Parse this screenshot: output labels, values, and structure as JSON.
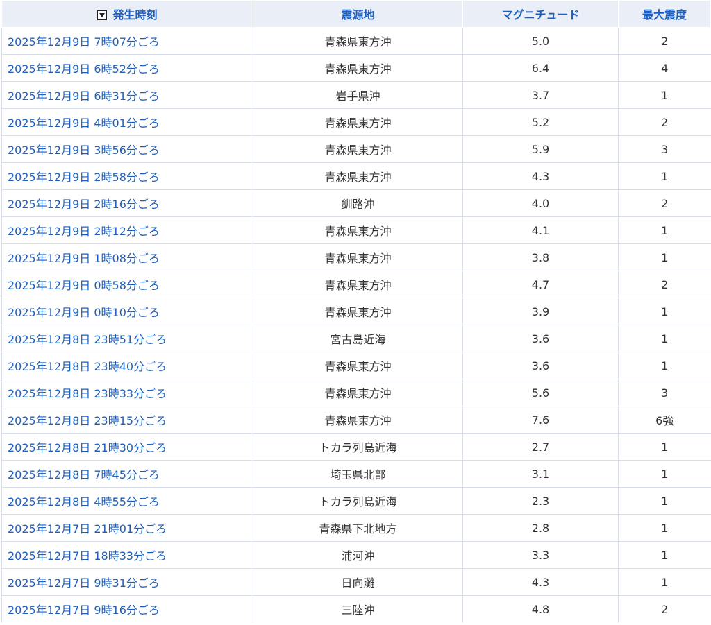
{
  "header": {
    "time_label": "発生時刻",
    "epicenter_label": "震源地",
    "magnitude_label": "マグニチュード",
    "intensity_label": "最大震度",
    "sort_icon": "sort-descending-icon"
  },
  "rows": [
    {
      "time": "2025年12月9日 7時07分ごろ",
      "epicenter": "青森県東方沖",
      "magnitude": "5.0",
      "intensity": "2"
    },
    {
      "time": "2025年12月9日 6時52分ごろ",
      "epicenter": "青森県東方沖",
      "magnitude": "6.4",
      "intensity": "4"
    },
    {
      "time": "2025年12月9日 6時31分ごろ",
      "epicenter": "岩手県沖",
      "magnitude": "3.7",
      "intensity": "1"
    },
    {
      "time": "2025年12月9日 4時01分ごろ",
      "epicenter": "青森県東方沖",
      "magnitude": "5.2",
      "intensity": "2"
    },
    {
      "time": "2025年12月9日 3時56分ごろ",
      "epicenter": "青森県東方沖",
      "magnitude": "5.9",
      "intensity": "3"
    },
    {
      "time": "2025年12月9日 2時58分ごろ",
      "epicenter": "青森県東方沖",
      "magnitude": "4.3",
      "intensity": "1"
    },
    {
      "time": "2025年12月9日 2時16分ごろ",
      "epicenter": "釧路沖",
      "magnitude": "4.0",
      "intensity": "2"
    },
    {
      "time": "2025年12月9日 2時12分ごろ",
      "epicenter": "青森県東方沖",
      "magnitude": "4.1",
      "intensity": "1"
    },
    {
      "time": "2025年12月9日 1時08分ごろ",
      "epicenter": "青森県東方沖",
      "magnitude": "3.8",
      "intensity": "1"
    },
    {
      "time": "2025年12月9日 0時58分ごろ",
      "epicenter": "青森県東方沖",
      "magnitude": "4.7",
      "intensity": "2"
    },
    {
      "time": "2025年12月9日 0時10分ごろ",
      "epicenter": "青森県東方沖",
      "magnitude": "3.9",
      "intensity": "1"
    },
    {
      "time": "2025年12月8日 23時51分ごろ",
      "epicenter": "宮古島近海",
      "magnitude": "3.6",
      "intensity": "1"
    },
    {
      "time": "2025年12月8日 23時40分ごろ",
      "epicenter": "青森県東方沖",
      "magnitude": "3.6",
      "intensity": "1"
    },
    {
      "time": "2025年12月8日 23時33分ごろ",
      "epicenter": "青森県東方沖",
      "magnitude": "5.6",
      "intensity": "3"
    },
    {
      "time": "2025年12月8日 23時15分ごろ",
      "epicenter": "青森県東方沖",
      "magnitude": "7.6",
      "intensity": "6強"
    },
    {
      "time": "2025年12月8日 21時30分ごろ",
      "epicenter": "トカラ列島近海",
      "magnitude": "2.7",
      "intensity": "1"
    },
    {
      "time": "2025年12月8日 7時45分ごろ",
      "epicenter": "埼玉県北部",
      "magnitude": "3.1",
      "intensity": "1"
    },
    {
      "time": "2025年12月8日 4時55分ごろ",
      "epicenter": "トカラ列島近海",
      "magnitude": "2.3",
      "intensity": "1"
    },
    {
      "time": "2025年12月7日 21時01分ごろ",
      "epicenter": "青森県下北地方",
      "magnitude": "2.8",
      "intensity": "1"
    },
    {
      "time": "2025年12月7日 18時33分ごろ",
      "epicenter": "浦河沖",
      "magnitude": "3.3",
      "intensity": "1"
    },
    {
      "time": "2025年12月7日 9時31分ごろ",
      "epicenter": "日向灘",
      "magnitude": "4.3",
      "intensity": "1"
    },
    {
      "time": "2025年12月7日 9時16分ごろ",
      "epicenter": "三陸沖",
      "magnitude": "4.8",
      "intensity": "2"
    }
  ]
}
